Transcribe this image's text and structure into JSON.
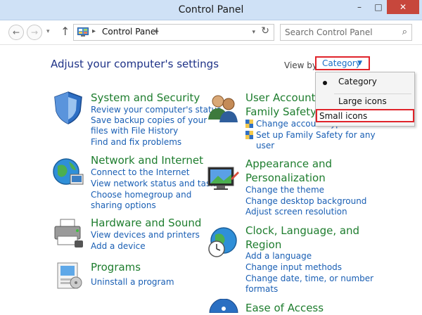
{
  "window": {
    "title": "Control Panel",
    "minimize": "–",
    "maximize": "□",
    "close": "✕"
  },
  "toolbar": {
    "back": "←",
    "forward": "→",
    "dropdown": "▾",
    "up": "↑",
    "address_sep": "▸",
    "address_text": "Control Panel",
    "address_chevron": "▸",
    "address_dropdown": "▾",
    "refresh": "↻",
    "search_placeholder": "Search Control Panel",
    "search_icon": "⌕"
  },
  "main": {
    "heading": "Adjust your computer's settings",
    "view_by_label": "View by:",
    "view_by_value": "Category",
    "view_by_caret": "▼"
  },
  "view_menu": {
    "items": [
      "Category",
      "Large icons",
      "Small icons"
    ],
    "selected": "Category"
  },
  "categories": {
    "system_security": {
      "title": "System and Security",
      "links": [
        "Review your computer's status",
        "Save backup copies of your",
        "files with File History",
        "Find and fix problems"
      ]
    },
    "network": {
      "title": "Network and Internet",
      "links": [
        "Connect to the Internet",
        "View network status and tasks",
        "Choose homegroup and",
        "sharing options"
      ]
    },
    "hardware": {
      "title": "Hardware and Sound",
      "links": [
        "View devices and printers",
        "Add a device"
      ]
    },
    "programs": {
      "title": "Programs",
      "links": [
        "Uninstall a program"
      ]
    },
    "user_accounts": {
      "title_line1": "User Accounts",
      "title_line2": "Family Safety",
      "links": [
        "Change account type",
        "Set up Family Safety for any",
        "user"
      ]
    },
    "appearance": {
      "title_line1": "Appearance and",
      "title_line2": "Personalization",
      "links": [
        "Change the theme",
        "Change desktop background",
        "Adjust screen resolution"
      ]
    },
    "clock": {
      "title_line1": "Clock, Language, and",
      "title_line2": "Region",
      "links": [
        "Add a language",
        "Change input methods",
        "Change date, time, or number",
        "formats"
      ]
    },
    "ease": {
      "title": "Ease of Access"
    }
  },
  "colors": {
    "title_bar": "#cfe1f6",
    "category_title": "#1e7d2e",
    "link": "#1a5fb4",
    "heading": "#1e3287",
    "highlight_box": "#e0242b",
    "close_button": "#c7473c"
  },
  "icons": [
    "control-panel-icon",
    "search-icon",
    "shield-icon",
    "globe-icon",
    "printer-icon",
    "programs-icon",
    "users-icon",
    "monitor-paint-icon",
    "clock-globe-icon",
    "ease-of-access-icon"
  ]
}
